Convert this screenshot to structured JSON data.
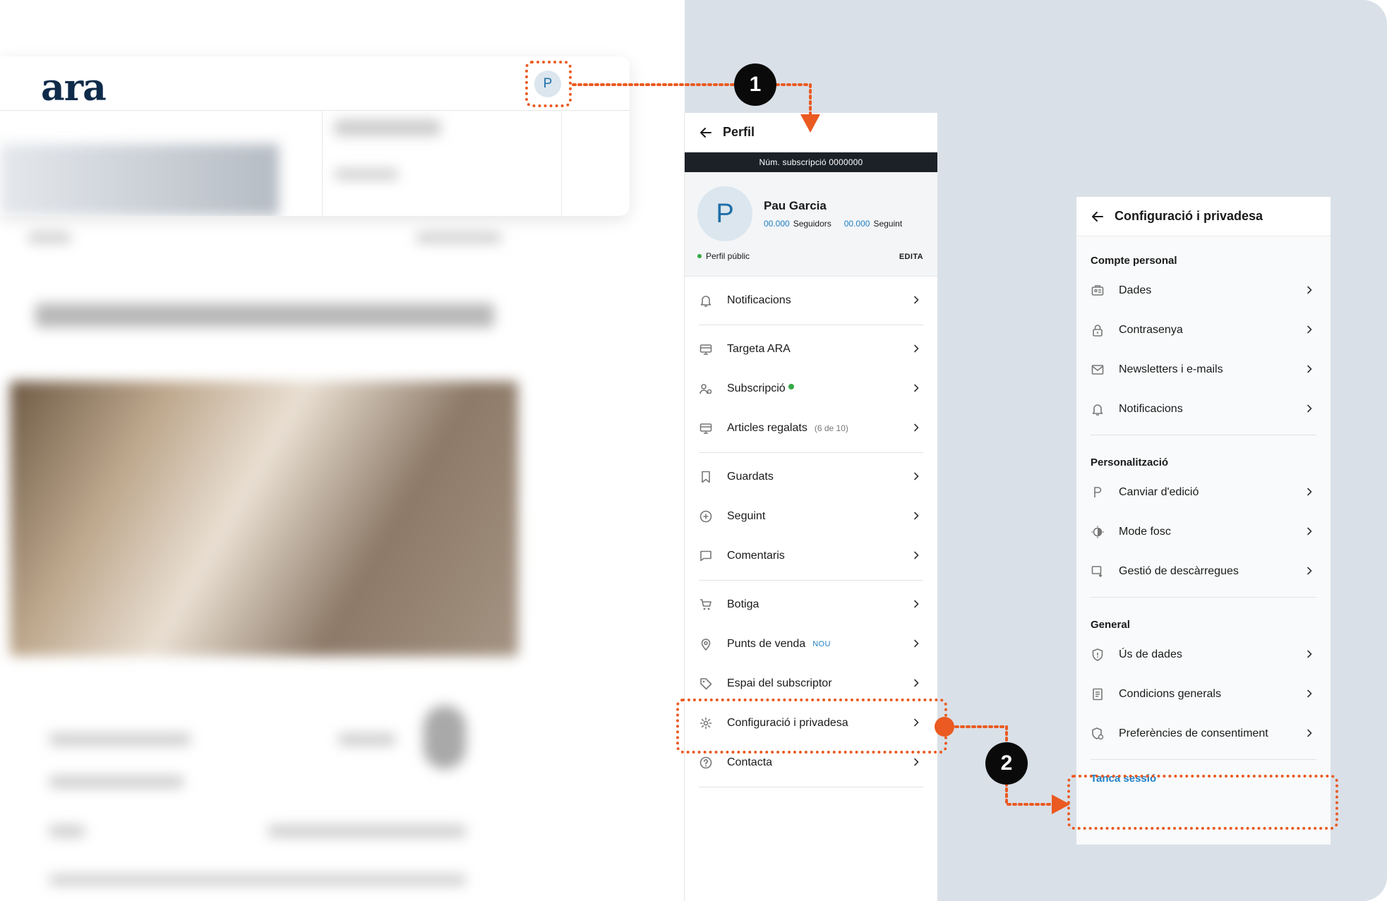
{
  "logo": "ara",
  "avatar_initial": "P",
  "profile_panel": {
    "title": "Perfil",
    "subscription_label": "Núm. subscripció 0000000",
    "user_name": "Pau Garcia",
    "followers_count": "00.000",
    "followers_label": "Seguidors",
    "following_count": "00.000",
    "following_label": "Seguint",
    "public_profile": "Perfil públic",
    "edit": "EDITA",
    "groups": [
      [
        {
          "label": "Notificacions",
          "icon": "bell-icon"
        }
      ],
      [
        {
          "label": "Targeta ARA",
          "icon": "card-icon"
        },
        {
          "label": "Subscripció",
          "icon": "subscription-icon",
          "dot": true
        },
        {
          "label": "Articles regalats",
          "icon": "gift-articles-icon",
          "note": "(6 de 10)"
        }
      ],
      [
        {
          "label": "Guardats",
          "icon": "bookmark-icon"
        },
        {
          "label": "Seguint",
          "icon": "plus-circle-icon"
        },
        {
          "label": "Comentaris",
          "icon": "comment-icon"
        }
      ],
      [
        {
          "label": "Botiga",
          "icon": "cart-icon"
        },
        {
          "label": "Punts de venda",
          "icon": "location-pin-icon",
          "badge": "NOU"
        },
        {
          "label": "Espai del subscriptor",
          "icon": "tag-icon"
        },
        {
          "label": "Configuració i privadesa",
          "icon": "gear-icon"
        },
        {
          "label": "Contacta",
          "icon": "help-circle-icon"
        }
      ]
    ]
  },
  "settings_panel": {
    "title": "Configuració i privadesa",
    "sections": [
      {
        "title": "Compte personal",
        "items": [
          {
            "label": "Dades",
            "icon": "id-card-icon"
          },
          {
            "label": "Contrasenya",
            "icon": "lock-icon"
          },
          {
            "label": "Newsletters i e-mails",
            "icon": "mail-icon"
          },
          {
            "label": "Notificacions",
            "icon": "bell-icon"
          }
        ]
      },
      {
        "title": "Personalització",
        "items": [
          {
            "label": "Canviar d'edició",
            "icon": "edition-p-icon"
          },
          {
            "label": "Mode fosc",
            "icon": "dark-mode-icon"
          },
          {
            "label": "Gestió de descàrregues",
            "icon": "download-icon"
          }
        ]
      },
      {
        "title": "General",
        "items": [
          {
            "label": "Ús de dades",
            "icon": "shield-icon"
          },
          {
            "label": "Condicions generals",
            "icon": "document-icon"
          },
          {
            "label": "Preferències de consentiment",
            "icon": "consent-shield-icon"
          }
        ]
      }
    ],
    "logout": "Tanca sessió"
  },
  "steps": [
    "1",
    "2"
  ],
  "colors": {
    "accent": "#ea5a21",
    "link": "#1f7fc4",
    "logo": "#0f2b4a",
    "bar": "#1c2128",
    "background": "#d9e0e8"
  }
}
